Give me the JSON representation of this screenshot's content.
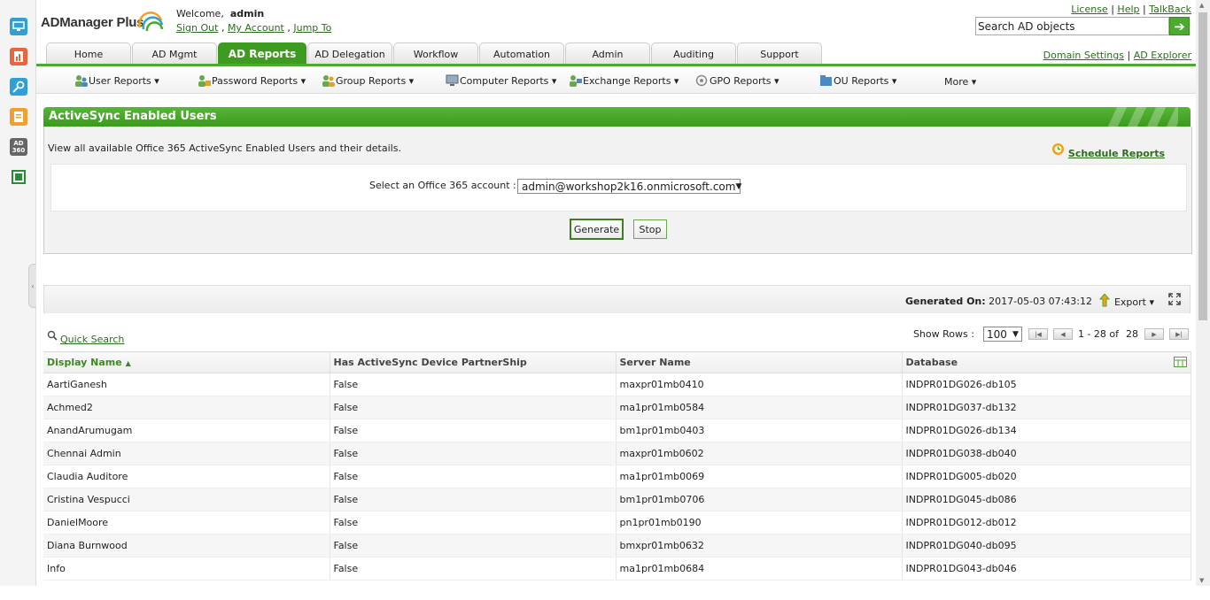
{
  "app": {
    "logo": "ADManager Plus",
    "welcome_label": "Welcome,",
    "username": "admin",
    "sign_out": "Sign Out",
    "my_account": "My Account",
    "jump_to": "Jump To",
    "separator": ",",
    "pipe": "|",
    "license": "License",
    "help": "Help",
    "talkback": "TalkBack",
    "search_placeholder": "Search AD objects",
    "search_go": "➔",
    "domain_settings": "Domain Settings",
    "ad_explorer": "AD Explorer"
  },
  "tabs": [
    {
      "label": "Home"
    },
    {
      "label": "AD Mgmt"
    },
    {
      "label": "AD Reports"
    },
    {
      "label": "AD Delegation"
    },
    {
      "label": "Workflow"
    },
    {
      "label": "Automation"
    },
    {
      "label": "Admin"
    },
    {
      "label": "Auditing"
    },
    {
      "label": "Support"
    }
  ],
  "active_tab": "AD Reports",
  "subnav": [
    {
      "label": "User Reports ▾",
      "icon": "users-icon"
    },
    {
      "label": "Password Reports ▾",
      "icon": "password-icon"
    },
    {
      "label": "Group Reports ▾",
      "icon": "group-icon"
    },
    {
      "label": "Computer Reports ▾",
      "icon": "computer-icon"
    },
    {
      "label": "Exchange Reports ▾",
      "icon": "exchange-icon"
    },
    {
      "label": "GPO Reports ▾",
      "icon": "gpo-icon"
    },
    {
      "label": "OU Reports ▾",
      "icon": "ou-icon"
    },
    {
      "label": "More ▾",
      "icon": ""
    }
  ],
  "panel": {
    "title": "ActiveSync Enabled Users",
    "description": "View all available Office 365 ActiveSync Enabled Users and their details.",
    "schedule": "Schedule Reports",
    "account_label": "Select an Office 365 account :",
    "account_value": "admin@workshop2k16.onmicrosoft.com",
    "generate": "Generate",
    "stop": "Stop"
  },
  "results": {
    "generated_label": "Generated On:",
    "generated_value": "2017-05-03 07:43:12",
    "export": "Export ▾",
    "quick_search": "Quick Search",
    "show_rows_label": "Show Rows :",
    "show_rows_value": "100",
    "range": "1 - 28 of",
    "total": "28",
    "columns": [
      "Display Name",
      "Has ActiveSync Device PartnerShip",
      "Server Name",
      "Database"
    ],
    "rows": [
      [
        "AartiGanesh",
        "False",
        "maxpr01mb0410",
        "INDPR01DG026-db105"
      ],
      [
        "Achmed2",
        "False",
        "ma1pr01mb0584",
        "INDPR01DG037-db132"
      ],
      [
        "AnandArumugam",
        "False",
        "bm1pr01mb0403",
        "INDPR01DG026-db134"
      ],
      [
        "Chennai Admin",
        "False",
        "maxpr01mb0602",
        "INDPR01DG038-db040"
      ],
      [
        "Claudia Auditore",
        "False",
        "ma1pr01mb0069",
        "INDPR01DG005-db020"
      ],
      [
        "Cristina Vespucci",
        "False",
        "bm1pr01mb0706",
        "INDPR01DG045-db086"
      ],
      [
        "DanielMoore",
        "False",
        "pn1pr01mb0190",
        "INDPR01DG012-db012"
      ],
      [
        "Diana Burnwood",
        "False",
        "bmxpr01mb0632",
        "INDPR01DG040-db095"
      ],
      [
        "Info",
        "False",
        "ma1pr01mb0684",
        "INDPR01DG043-db046"
      ]
    ]
  },
  "colors": {
    "accent": "#3d9b1f",
    "link": "#2a6e1a"
  }
}
